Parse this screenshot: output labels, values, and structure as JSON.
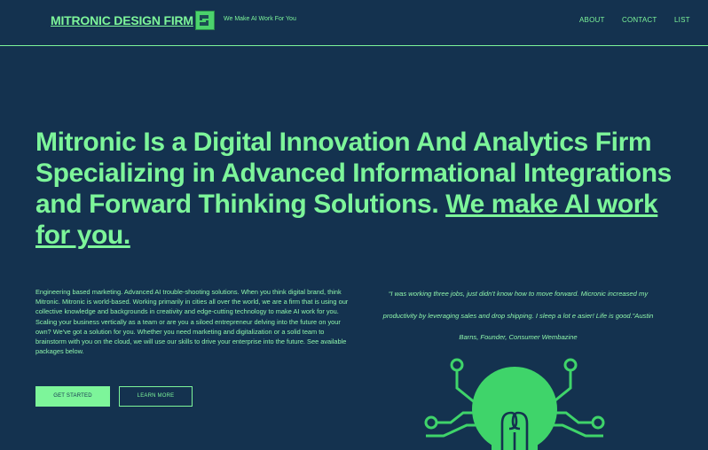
{
  "header": {
    "brand": "MITRONIC DESIGN FIRM",
    "tagline": "We Make AI Work For You",
    "nav": [
      "ABOUT",
      "CONTACT",
      "LIST"
    ]
  },
  "hero": {
    "headline_main": "Mitronic Is a Digital Innovation And Analytics Firm Specializing in Advanced Informational Integrations and Forward Thinking Solutions.",
    "headline_emphasis": "We make AI work for you."
  },
  "intro": {
    "body": "Engineering based marketing. Advanced AI trouble-shooting solutions. When you think digital brand, think Mitronic. Mitronic is world-based. Working primarily in cities all over the world, we are a firm that is using our collective knowledge and backgrounds in creativity and edge-cutting technology to make AI work for you. Scaling your business vertically as a team or are you a siloed entrepreneur delving into the future on your own? We've got a solution for you. Whether you need marketing and digitalization or a solid team to brainstorm with you on the cloud, we will use our skills to drive your enterprise into the future. See available packages below.",
    "get_started_label": "GET STARTED",
    "learn_more_label": "LEARN MORE"
  },
  "testimonial": {
    "quote": "“I was working three jobs, just didn't know how to move forward. Micronic increased my productivity by leveraging sales and drop shipping. I sleep a lot e asier! Life is good.”Austin Barns, Founder, Consumer Wembazine"
  },
  "icons": {
    "logo": "mitronic-logo-icon",
    "illustration": "circuit-lightbulb-icon"
  },
  "colors": {
    "background": "#14324f",
    "accent": "#7df59a",
    "bulb": "#3fd46a"
  }
}
